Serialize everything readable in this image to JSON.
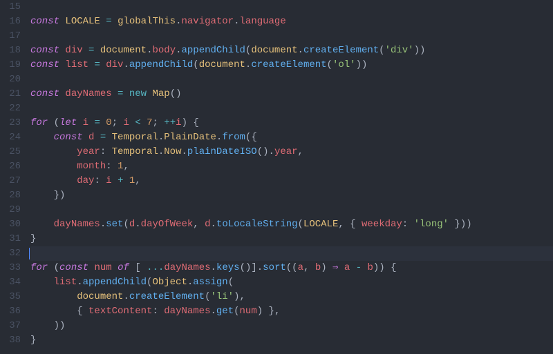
{
  "editor": {
    "lines": [
      {
        "num": 15,
        "hl": false,
        "tokens": []
      },
      {
        "num": 16,
        "hl": false,
        "tokens": [
          {
            "c": "t-key",
            "t": "const"
          },
          {
            "c": "t-plain",
            "t": " "
          },
          {
            "c": "t-const",
            "t": "LOCALE"
          },
          {
            "c": "t-plain",
            "t": " "
          },
          {
            "c": "t-op",
            "t": "="
          },
          {
            "c": "t-plain",
            "t": " "
          },
          {
            "c": "t-cls",
            "t": "globalThis"
          },
          {
            "c": "t-punc",
            "t": "."
          },
          {
            "c": "t-prop",
            "t": "navigator"
          },
          {
            "c": "t-punc",
            "t": "."
          },
          {
            "c": "t-prop",
            "t": "language"
          }
        ]
      },
      {
        "num": 17,
        "hl": false,
        "tokens": []
      },
      {
        "num": 18,
        "hl": false,
        "tokens": [
          {
            "c": "t-key",
            "t": "const"
          },
          {
            "c": "t-plain",
            "t": " "
          },
          {
            "c": "t-var",
            "t": "div"
          },
          {
            "c": "t-plain",
            "t": " "
          },
          {
            "c": "t-op",
            "t": "="
          },
          {
            "c": "t-plain",
            "t": " "
          },
          {
            "c": "t-cls",
            "t": "document"
          },
          {
            "c": "t-punc",
            "t": "."
          },
          {
            "c": "t-prop",
            "t": "body"
          },
          {
            "c": "t-punc",
            "t": "."
          },
          {
            "c": "t-func",
            "t": "appendChild"
          },
          {
            "c": "t-punc",
            "t": "("
          },
          {
            "c": "t-cls",
            "t": "document"
          },
          {
            "c": "t-punc",
            "t": "."
          },
          {
            "c": "t-func",
            "t": "createElement"
          },
          {
            "c": "t-punc",
            "t": "("
          },
          {
            "c": "t-str",
            "t": "'div'"
          },
          {
            "c": "t-punc",
            "t": "))"
          }
        ]
      },
      {
        "num": 19,
        "hl": false,
        "tokens": [
          {
            "c": "t-key",
            "t": "const"
          },
          {
            "c": "t-plain",
            "t": " "
          },
          {
            "c": "t-var",
            "t": "list"
          },
          {
            "c": "t-plain",
            "t": " "
          },
          {
            "c": "t-op",
            "t": "="
          },
          {
            "c": "t-plain",
            "t": " "
          },
          {
            "c": "t-var",
            "t": "div"
          },
          {
            "c": "t-punc",
            "t": "."
          },
          {
            "c": "t-func",
            "t": "appendChild"
          },
          {
            "c": "t-punc",
            "t": "("
          },
          {
            "c": "t-cls",
            "t": "document"
          },
          {
            "c": "t-punc",
            "t": "."
          },
          {
            "c": "t-func",
            "t": "createElement"
          },
          {
            "c": "t-punc",
            "t": "("
          },
          {
            "c": "t-str",
            "t": "'ol'"
          },
          {
            "c": "t-punc",
            "t": "))"
          }
        ]
      },
      {
        "num": 20,
        "hl": false,
        "tokens": []
      },
      {
        "num": 21,
        "hl": false,
        "tokens": [
          {
            "c": "t-key",
            "t": "const"
          },
          {
            "c": "t-plain",
            "t": " "
          },
          {
            "c": "t-var",
            "t": "dayNames"
          },
          {
            "c": "t-plain",
            "t": " "
          },
          {
            "c": "t-op",
            "t": "="
          },
          {
            "c": "t-plain",
            "t": " "
          },
          {
            "c": "t-op",
            "t": "new"
          },
          {
            "c": "t-plain",
            "t": " "
          },
          {
            "c": "t-cls",
            "t": "Map"
          },
          {
            "c": "t-punc",
            "t": "()"
          }
        ]
      },
      {
        "num": 22,
        "hl": false,
        "tokens": []
      },
      {
        "num": 23,
        "hl": false,
        "tokens": [
          {
            "c": "t-key",
            "t": "for"
          },
          {
            "c": "t-plain",
            "t": " "
          },
          {
            "c": "t-punc",
            "t": "("
          },
          {
            "c": "t-key",
            "t": "let"
          },
          {
            "c": "t-plain",
            "t": " "
          },
          {
            "c": "t-var",
            "t": "i"
          },
          {
            "c": "t-plain",
            "t": " "
          },
          {
            "c": "t-op",
            "t": "="
          },
          {
            "c": "t-plain",
            "t": " "
          },
          {
            "c": "t-num",
            "t": "0"
          },
          {
            "c": "t-punc",
            "t": "; "
          },
          {
            "c": "t-var",
            "t": "i"
          },
          {
            "c": "t-plain",
            "t": " "
          },
          {
            "c": "t-op",
            "t": "<"
          },
          {
            "c": "t-plain",
            "t": " "
          },
          {
            "c": "t-num",
            "t": "7"
          },
          {
            "c": "t-punc",
            "t": "; "
          },
          {
            "c": "t-op",
            "t": "++"
          },
          {
            "c": "t-var",
            "t": "i"
          },
          {
            "c": "t-punc",
            "t": ") {"
          }
        ]
      },
      {
        "num": 24,
        "hl": false,
        "tokens": [
          {
            "c": "t-plain",
            "t": "    "
          },
          {
            "c": "t-key",
            "t": "const"
          },
          {
            "c": "t-plain",
            "t": " "
          },
          {
            "c": "t-var",
            "t": "d"
          },
          {
            "c": "t-plain",
            "t": " "
          },
          {
            "c": "t-op",
            "t": "="
          },
          {
            "c": "t-plain",
            "t": " "
          },
          {
            "c": "t-cls",
            "t": "Temporal"
          },
          {
            "c": "t-punc",
            "t": "."
          },
          {
            "c": "t-cls",
            "t": "PlainDate"
          },
          {
            "c": "t-punc",
            "t": "."
          },
          {
            "c": "t-func",
            "t": "from"
          },
          {
            "c": "t-punc",
            "t": "({"
          }
        ]
      },
      {
        "num": 25,
        "hl": false,
        "tokens": [
          {
            "c": "t-plain",
            "t": "        "
          },
          {
            "c": "t-prop",
            "t": "year"
          },
          {
            "c": "t-punc",
            "t": ": "
          },
          {
            "c": "t-cls",
            "t": "Temporal"
          },
          {
            "c": "t-punc",
            "t": "."
          },
          {
            "c": "t-cls",
            "t": "Now"
          },
          {
            "c": "t-punc",
            "t": "."
          },
          {
            "c": "t-func",
            "t": "plainDateISO"
          },
          {
            "c": "t-punc",
            "t": "()."
          },
          {
            "c": "t-prop",
            "t": "year"
          },
          {
            "c": "t-punc",
            "t": ","
          }
        ]
      },
      {
        "num": 26,
        "hl": false,
        "tokens": [
          {
            "c": "t-plain",
            "t": "        "
          },
          {
            "c": "t-prop",
            "t": "month"
          },
          {
            "c": "t-punc",
            "t": ": "
          },
          {
            "c": "t-num",
            "t": "1"
          },
          {
            "c": "t-punc",
            "t": ","
          }
        ]
      },
      {
        "num": 27,
        "hl": false,
        "tokens": [
          {
            "c": "t-plain",
            "t": "        "
          },
          {
            "c": "t-prop",
            "t": "day"
          },
          {
            "c": "t-punc",
            "t": ": "
          },
          {
            "c": "t-var",
            "t": "i"
          },
          {
            "c": "t-plain",
            "t": " "
          },
          {
            "c": "t-op",
            "t": "+"
          },
          {
            "c": "t-plain",
            "t": " "
          },
          {
            "c": "t-num",
            "t": "1"
          },
          {
            "c": "t-punc",
            "t": ","
          }
        ]
      },
      {
        "num": 28,
        "hl": false,
        "tokens": [
          {
            "c": "t-plain",
            "t": "    "
          },
          {
            "c": "t-punc",
            "t": "})"
          }
        ]
      },
      {
        "num": 29,
        "hl": false,
        "tokens": []
      },
      {
        "num": 30,
        "hl": false,
        "tokens": [
          {
            "c": "t-plain",
            "t": "    "
          },
          {
            "c": "t-var",
            "t": "dayNames"
          },
          {
            "c": "t-punc",
            "t": "."
          },
          {
            "c": "t-func",
            "t": "set"
          },
          {
            "c": "t-punc",
            "t": "("
          },
          {
            "c": "t-var",
            "t": "d"
          },
          {
            "c": "t-punc",
            "t": "."
          },
          {
            "c": "t-prop",
            "t": "dayOfWeek"
          },
          {
            "c": "t-punc",
            "t": ", "
          },
          {
            "c": "t-var",
            "t": "d"
          },
          {
            "c": "t-punc",
            "t": "."
          },
          {
            "c": "t-func",
            "t": "toLocaleString"
          },
          {
            "c": "t-punc",
            "t": "("
          },
          {
            "c": "t-const",
            "t": "LOCALE"
          },
          {
            "c": "t-punc",
            "t": ", { "
          },
          {
            "c": "t-prop",
            "t": "weekday"
          },
          {
            "c": "t-punc",
            "t": ": "
          },
          {
            "c": "t-str",
            "t": "'long'"
          },
          {
            "c": "t-punc",
            "t": " }))"
          }
        ]
      },
      {
        "num": 31,
        "hl": false,
        "tokens": [
          {
            "c": "t-punc",
            "t": "}"
          }
        ]
      },
      {
        "num": 32,
        "hl": true,
        "cursor": true,
        "tokens": []
      },
      {
        "num": 33,
        "hl": false,
        "tokens": [
          {
            "c": "t-key",
            "t": "for"
          },
          {
            "c": "t-plain",
            "t": " "
          },
          {
            "c": "t-punc",
            "t": "("
          },
          {
            "c": "t-key",
            "t": "const"
          },
          {
            "c": "t-plain",
            "t": " "
          },
          {
            "c": "t-var",
            "t": "num"
          },
          {
            "c": "t-plain",
            "t": " "
          },
          {
            "c": "t-key",
            "t": "of"
          },
          {
            "c": "t-plain",
            "t": " "
          },
          {
            "c": "t-punc",
            "t": "[ "
          },
          {
            "c": "t-op",
            "t": "..."
          },
          {
            "c": "t-var",
            "t": "dayNames"
          },
          {
            "c": "t-punc",
            "t": "."
          },
          {
            "c": "t-func",
            "t": "keys"
          },
          {
            "c": "t-punc",
            "t": "()]."
          },
          {
            "c": "t-func",
            "t": "sort"
          },
          {
            "c": "t-punc",
            "t": "(("
          },
          {
            "c": "t-var",
            "t": "a"
          },
          {
            "c": "t-punc",
            "t": ", "
          },
          {
            "c": "t-var",
            "t": "b"
          },
          {
            "c": "t-punc",
            "t": ") "
          },
          {
            "c": "t-key",
            "t": "⇒"
          },
          {
            "c": "t-plain",
            "t": " "
          },
          {
            "c": "t-var",
            "t": "a"
          },
          {
            "c": "t-plain",
            "t": " "
          },
          {
            "c": "t-op",
            "t": "-"
          },
          {
            "c": "t-plain",
            "t": " "
          },
          {
            "c": "t-var",
            "t": "b"
          },
          {
            "c": "t-punc",
            "t": ")) {"
          }
        ]
      },
      {
        "num": 34,
        "hl": false,
        "tokens": [
          {
            "c": "t-plain",
            "t": "    "
          },
          {
            "c": "t-var",
            "t": "list"
          },
          {
            "c": "t-punc",
            "t": "."
          },
          {
            "c": "t-func",
            "t": "appendChild"
          },
          {
            "c": "t-punc",
            "t": "("
          },
          {
            "c": "t-cls",
            "t": "Object"
          },
          {
            "c": "t-punc",
            "t": "."
          },
          {
            "c": "t-func",
            "t": "assign"
          },
          {
            "c": "t-punc",
            "t": "("
          }
        ]
      },
      {
        "num": 35,
        "hl": false,
        "tokens": [
          {
            "c": "t-plain",
            "t": "        "
          },
          {
            "c": "t-cls",
            "t": "document"
          },
          {
            "c": "t-punc",
            "t": "."
          },
          {
            "c": "t-func",
            "t": "createElement"
          },
          {
            "c": "t-punc",
            "t": "("
          },
          {
            "c": "t-str",
            "t": "'li'"
          },
          {
            "c": "t-punc",
            "t": "),"
          }
        ]
      },
      {
        "num": 36,
        "hl": false,
        "tokens": [
          {
            "c": "t-plain",
            "t": "        "
          },
          {
            "c": "t-punc",
            "t": "{ "
          },
          {
            "c": "t-prop",
            "t": "textContent"
          },
          {
            "c": "t-punc",
            "t": ": "
          },
          {
            "c": "t-var",
            "t": "dayNames"
          },
          {
            "c": "t-punc",
            "t": "."
          },
          {
            "c": "t-func",
            "t": "get"
          },
          {
            "c": "t-punc",
            "t": "("
          },
          {
            "c": "t-var",
            "t": "num"
          },
          {
            "c": "t-punc",
            "t": ") },"
          }
        ]
      },
      {
        "num": 37,
        "hl": false,
        "tokens": [
          {
            "c": "t-plain",
            "t": "    "
          },
          {
            "c": "t-punc",
            "t": "))"
          }
        ]
      },
      {
        "num": 38,
        "hl": false,
        "tokens": [
          {
            "c": "t-punc",
            "t": "}"
          }
        ]
      }
    ]
  }
}
